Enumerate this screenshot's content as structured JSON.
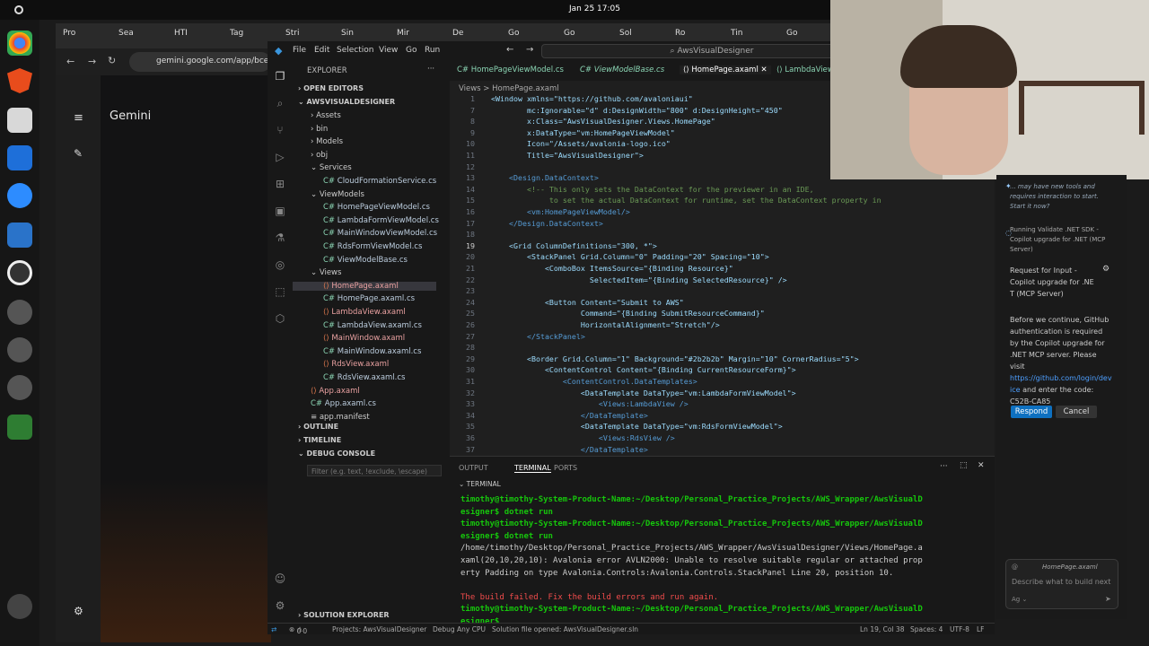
{
  "topbar": {
    "clock": "Jan 25  17:05"
  },
  "browser": {
    "tabs": [
      "Pro",
      "Sea",
      "HTI",
      "Tag",
      "Stri",
      "Sin",
      "Mir",
      "De",
      "Go",
      "Go",
      "Sol",
      "Ro",
      "Tin",
      "Go"
    ],
    "url": "gemini.google.com/app/bce75",
    "gemini_title": "Gemini"
  },
  "vscode": {
    "menu": [
      "File",
      "Edit",
      "Selection",
      "View",
      "Go",
      "Run"
    ],
    "command_center": "AwsVisualDesigner",
    "explorer_header": "EXPLORER",
    "open_editors": "OPEN EDITORS",
    "project": "AWSVISUALDESIGNER",
    "tree": [
      {
        "label": "Assets",
        "type": "folder",
        "indent": 1,
        "open": false
      },
      {
        "label": "bin",
        "type": "folder",
        "indent": 1,
        "open": false
      },
      {
        "label": "Models",
        "type": "folder",
        "indent": 1,
        "open": false
      },
      {
        "label": "obj",
        "type": "folder",
        "indent": 1,
        "open": false
      },
      {
        "label": "Services",
        "type": "folder",
        "indent": 1,
        "open": true
      },
      {
        "label": "CloudFormationService.cs",
        "type": "cs",
        "indent": 2
      },
      {
        "label": "ViewModels",
        "type": "folder",
        "indent": 1,
        "open": true
      },
      {
        "label": "HomePageViewModel.cs",
        "type": "cs",
        "indent": 2
      },
      {
        "label": "LambdaFormViewModel.cs",
        "type": "cs",
        "indent": 2
      },
      {
        "label": "MainWindowViewModel.cs",
        "type": "cs",
        "indent": 2
      },
      {
        "label": "RdsFormViewModel.cs",
        "type": "cs",
        "indent": 2
      },
      {
        "label": "ViewModelBase.cs",
        "type": "cs",
        "indent": 2
      },
      {
        "label": "Views",
        "type": "folder",
        "indent": 1,
        "open": true
      },
      {
        "label": "HomePage.axaml",
        "type": "ax",
        "indent": 2,
        "selected": true
      },
      {
        "label": "HomePage.axaml.cs",
        "type": "cs",
        "indent": 2
      },
      {
        "label": "LambdaView.axaml",
        "type": "ax",
        "indent": 2
      },
      {
        "label": "LambdaView.axaml.cs",
        "type": "cs",
        "indent": 2
      },
      {
        "label": "MainWindow.axaml",
        "type": "ax",
        "indent": 2
      },
      {
        "label": "MainWindow.axaml.cs",
        "type": "cs",
        "indent": 2
      },
      {
        "label": "RdsView.axaml",
        "type": "ax",
        "indent": 2
      },
      {
        "label": "RdsView.axaml.cs",
        "type": "cs",
        "indent": 2
      },
      {
        "label": "App.axaml",
        "type": "ax",
        "indent": 1
      },
      {
        "label": "App.axaml.cs",
        "type": "cs",
        "indent": 1
      },
      {
        "label": "app.manifest",
        "type": "file",
        "indent": 1
      }
    ],
    "outline": "OUTLINE",
    "timeline": "TIMELINE",
    "debug_console": "DEBUG CONSOLE",
    "filter_placeholder": "Filter (e.g. text, !exclude, \\escape)",
    "solution_explorer": "SOLUTION EXPLORER",
    "editor_tabs": [
      "HomePageViewModel.cs",
      "ViewModelBase.cs",
      "HomePage.axaml",
      "LambdaView"
    ],
    "breadcrumb": "Views  >  HomePage.axaml",
    "code": [
      {
        "n": "1",
        "t": "<Window xmlns=\"https://github.com/avaloniaui\""
      },
      {
        "n": "7",
        "t": "        mc:Ignorable=\"d\" d:DesignWidth=\"800\" d:DesignHeight=\"450\""
      },
      {
        "n": "8",
        "t": "        x:Class=\"AwsVisualDesigner.Views.HomePage\""
      },
      {
        "n": "9",
        "t": "        x:DataType=\"vm:HomePageViewModel\""
      },
      {
        "n": "10",
        "t": "        Icon=\"/Assets/avalonia-logo.ico\""
      },
      {
        "n": "11",
        "t": "        Title=\"AwsVisualDesigner\">"
      },
      {
        "n": "12",
        "t": ""
      },
      {
        "n": "13",
        "t": "    <Design.DataContext>"
      },
      {
        "n": "14",
        "t": "        <!-- This only sets the DataContext for the previewer in an IDE,"
      },
      {
        "n": "15",
        "t": "             to set the actual DataContext for runtime, set the DataContext property in"
      },
      {
        "n": "16",
        "t": "        <vm:HomePageViewModel/>"
      },
      {
        "n": "17",
        "t": "    </Design.DataContext>"
      },
      {
        "n": "18",
        "t": ""
      },
      {
        "n": "19",
        "t": "    <Grid ColumnDefinitions=\"300, *\">"
      },
      {
        "n": "20",
        "t": "        <StackPanel Grid.Column=\"0\" Padding=\"20\" Spacing=\"10\">"
      },
      {
        "n": "21",
        "t": "            <ComboBox ItemsSource=\"{Binding Resource}\""
      },
      {
        "n": "22",
        "t": "                      SelectedItem=\"{Binding SelectedResource}\" />"
      },
      {
        "n": "23",
        "t": ""
      },
      {
        "n": "24",
        "t": "            <Button Content=\"Submit to AWS\""
      },
      {
        "n": "25",
        "t": "                    Command=\"{Binding SubmitResourceCommand}\""
      },
      {
        "n": "26",
        "t": "                    HorizontalAlignment=\"Stretch\"/>"
      },
      {
        "n": "27",
        "t": "        </StackPanel>"
      },
      {
        "n": "28",
        "t": ""
      },
      {
        "n": "29",
        "t": "        <Border Grid.Column=\"1\" Background=\"#2b2b2b\" Margin=\"10\" CornerRadius=\"5\">"
      },
      {
        "n": "30",
        "t": "            <ContentControl Content=\"{Binding CurrentResourceForm}\">"
      },
      {
        "n": "31",
        "t": "                <ContentControl.DataTemplates>"
      },
      {
        "n": "32",
        "t": "                    <DataTemplate DataType=\"vm:LambdaFormViewModel\">"
      },
      {
        "n": "33",
        "t": "                        <Views:LambdaView />"
      },
      {
        "n": "34",
        "t": "                    </DataTemplate>"
      },
      {
        "n": "35",
        "t": "                    <DataTemplate DataType=\"vm:RdsFormViewModel\">"
      },
      {
        "n": "36",
        "t": "                        <Views:RdsView />"
      },
      {
        "n": "37",
        "t": "                    </DataTemplate>"
      }
    ],
    "panel_tabs": [
      "OUTPUT",
      "TERMINAL",
      "PORTS"
    ],
    "terminal_label": "TERMINAL",
    "terminal": [
      {
        "cls": "g",
        "t": "timothy@timothy-System-Product-Name:~/Desktop/Personal_Practice_Projects/AWS_Wrapper/AwsVisualD"
      },
      {
        "cls": "g",
        "t": "esigner$ dotnet run"
      },
      {
        "cls": "g",
        "t": "timothy@timothy-System-Product-Name:~/Desktop/Personal_Practice_Projects/AWS_Wrapper/AwsVisualD"
      },
      {
        "cls": "g",
        "t": "esigner$ dotnet run"
      },
      {
        "cls": "",
        "t": "/home/timothy/Desktop/Personal_Practice_Projects/AWS_Wrapper/AwsVisualDesigner/Views/HomePage.a"
      },
      {
        "cls": "",
        "t": "xaml(20,10,20,10): Avalonia error AVLN2000: Unable to resolve suitable regular or attached prop"
      },
      {
        "cls": "",
        "t": "erty Padding on type Avalonia.Controls:Avalonia.Controls.StackPanel Line 20, position 10."
      },
      {
        "cls": "",
        "t": ""
      },
      {
        "cls": "r",
        "t": "The build failed. Fix the build errors and run again."
      },
      {
        "cls": "g",
        "t": "timothy@timothy-System-Product-Name:~/Desktop/Personal_Practice_Projects/AWS_Wrapper/AwsVisualD"
      },
      {
        "cls": "g",
        "t": "esigner$ "
      }
    ],
    "status": {
      "projects": "Projects: AwsVisualDesigner",
      "debug": "Debug Any CPU",
      "solution": "Solution file opened: AwsVisualDesigner.sln",
      "position": "Ln 19, Col 38",
      "spaces": "Spaces: 4",
      "encoding": "UTF-8",
      "eol": "LF",
      "errors": "0"
    }
  },
  "copilot": {
    "notice1": "... may have new tools and requires interaction to start. Start it now?",
    "running": "Running Validate .NET SDK - Copilot upgrade for .NET (MCP Server)",
    "request_title": "Request for Input - Copilot upgrade for .NE T (MCP Server)",
    "body_text": "Before we continue, GitHub authentication is required by the Copilot upgrade for .NET MCP server. Please visit",
    "link": "https://github.com/login/dev ice",
    "code_text": "and enter the code: C52B-CA85",
    "respond": "Respond",
    "cancel": "Cancel",
    "chat_file": "HomePage.axaml",
    "chat_placeholder": "Describe what to build next"
  }
}
